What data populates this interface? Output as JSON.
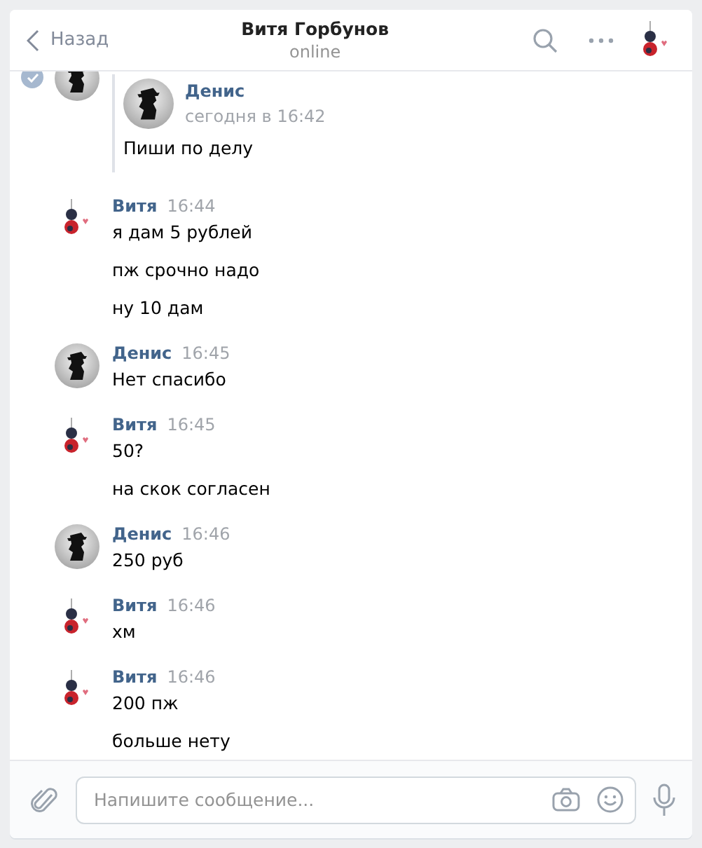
{
  "header": {
    "back": "Назад",
    "title": "Витя Горбунов",
    "status": "online"
  },
  "messages": [
    {
      "kind": "denis",
      "selected": true,
      "forward": {
        "name": "Денис",
        "time": "сегодня в 16:42",
        "text": "Пиши по делу"
      }
    },
    {
      "kind": "vitya",
      "name": "Витя",
      "time": "16:44",
      "texts": [
        "я дам 5 рублей",
        "пж срочно надо",
        "ну 10 дам"
      ]
    },
    {
      "kind": "denis",
      "name": "Денис",
      "time": "16:45",
      "texts": [
        "Нет спасибо"
      ]
    },
    {
      "kind": "vitya",
      "name": "Витя",
      "time": "16:45",
      "texts": [
        "50?",
        "на скок согласен"
      ]
    },
    {
      "kind": "denis",
      "name": "Денис",
      "time": "16:46",
      "texts": [
        "250 руб"
      ]
    },
    {
      "kind": "vitya",
      "name": "Витя",
      "time": "16:46",
      "texts": [
        "хм"
      ]
    },
    {
      "kind": "vitya",
      "name": "Витя",
      "time": "16:46",
      "texts": [
        "200 пж",
        "больше нету"
      ]
    }
  ],
  "composer": {
    "placeholder": "Напишите сообщение..."
  }
}
